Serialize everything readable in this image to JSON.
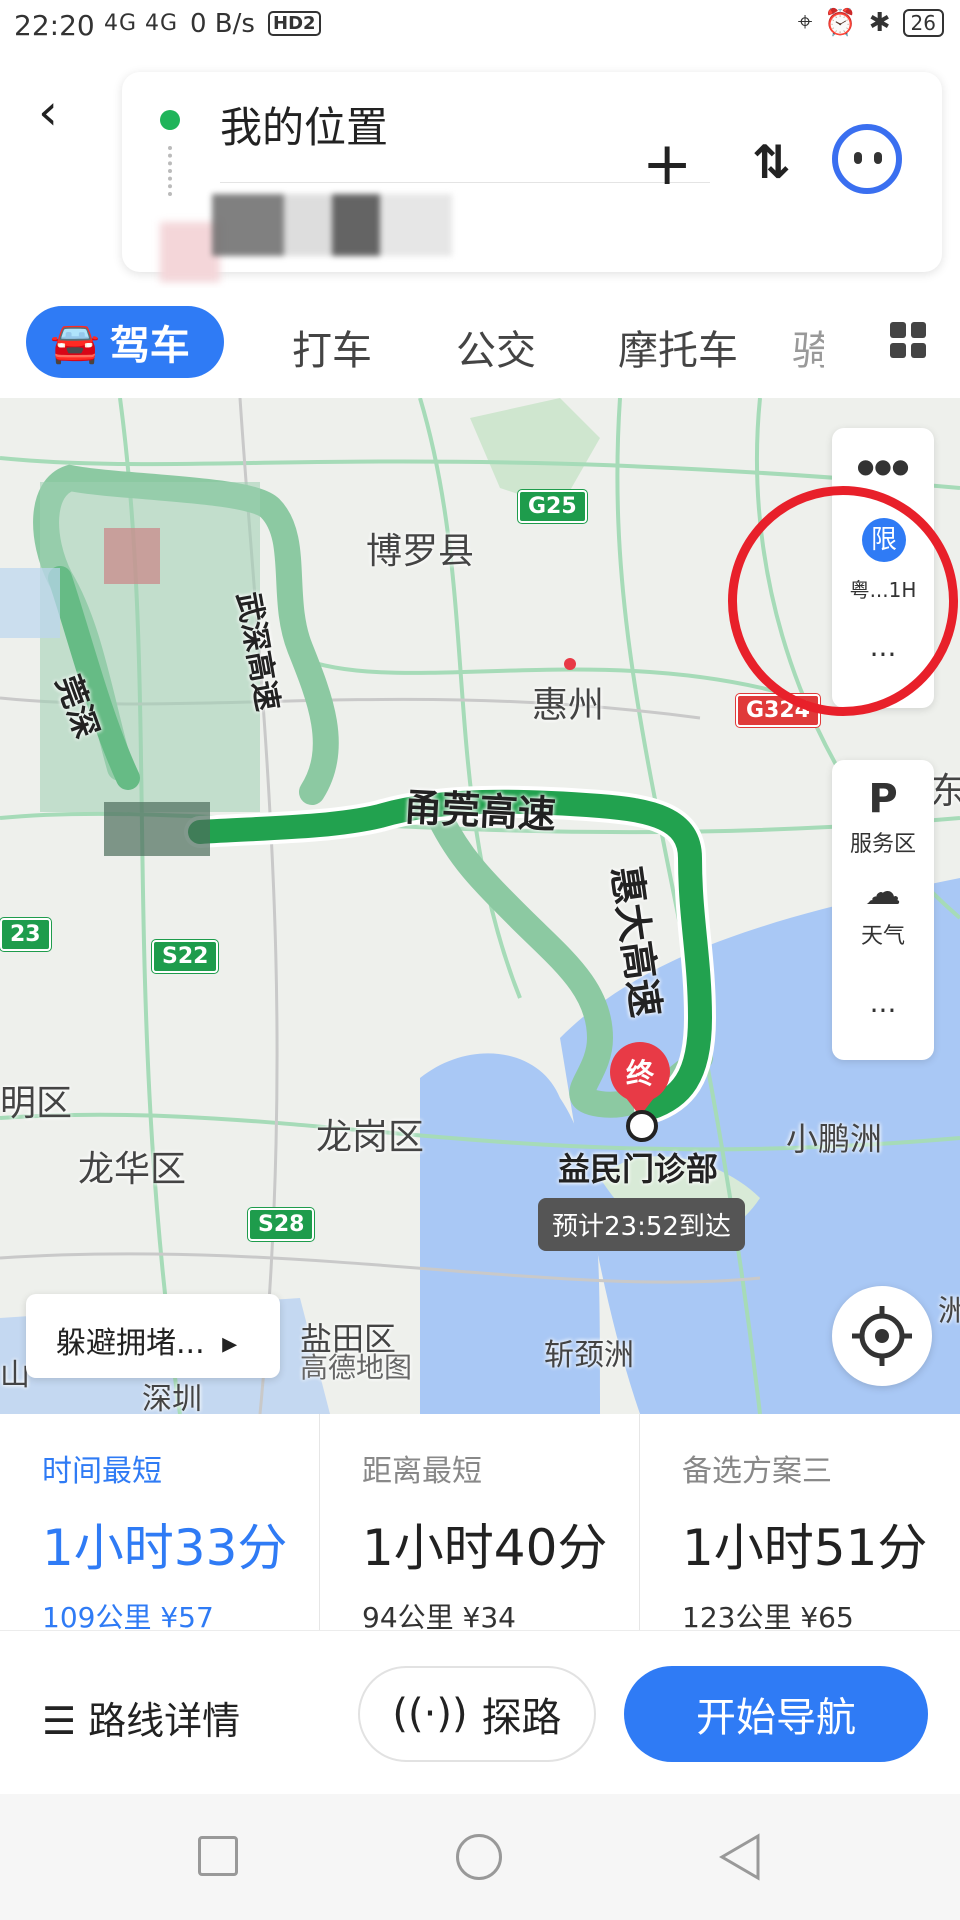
{
  "status_bar": {
    "time": "22:20",
    "network": "4G 4G",
    "speed": "0 B/s",
    "hd": "HD2",
    "battery": "26"
  },
  "search": {
    "origin": "我的位置"
  },
  "modes": {
    "drive": "驾车",
    "taxi": "打车",
    "bus": "公交",
    "moto": "摩托车",
    "partial": "骑"
  },
  "map": {
    "labels": {
      "boluo": "博罗县",
      "huizhou": "惠州",
      "longgang": "龙岗区",
      "longhua": "龙华区",
      "xiaopengzhou": "小鹏洲",
      "zhanjingzhou": "斩颈洲",
      "yantian": "盐田区",
      "amap": "高德地图",
      "shenzhen": "深圳",
      "mingqu": "明区",
      "dong": "东",
      "zhou_edge": "洲",
      "shan_edge": "山"
    },
    "road_names": {
      "wushen": "武深高速",
      "yongguan": "甬莞高速",
      "huida": "惠大高速",
      "guanshen": "莞深"
    },
    "road_signs": {
      "g25": "G25",
      "g324": "G324",
      "s22": "S22",
      "s28": "S28",
      "edge23": "23"
    },
    "destination": {
      "marker": "终",
      "name": "益民门诊部",
      "eta": "预计23:52到达"
    },
    "side_panel": {
      "restrict_icon": "限",
      "restrict_text": "粤...1H",
      "more": "···",
      "service": "服务区",
      "weather": "天气"
    },
    "avoid_button": "躲避拥堵..."
  },
  "routes": [
    {
      "label": "时间最短",
      "duration": "1小时33分",
      "meta": "109公里 ¥57",
      "selected": true
    },
    {
      "label": "距离最短",
      "duration": "1小时40分",
      "meta": "94公里 ¥34",
      "selected": false
    },
    {
      "label": "备选方案三",
      "duration": "1小时51分",
      "meta": "123公里 ¥65",
      "selected": false
    }
  ],
  "actions": {
    "details": "路线详情",
    "probe": "探路",
    "start": "开始导航"
  },
  "colors": {
    "accent": "#2f7bf5",
    "route": "#22a24f",
    "alt_route": "#8cc9a2",
    "annotation": "#e8202a"
  }
}
